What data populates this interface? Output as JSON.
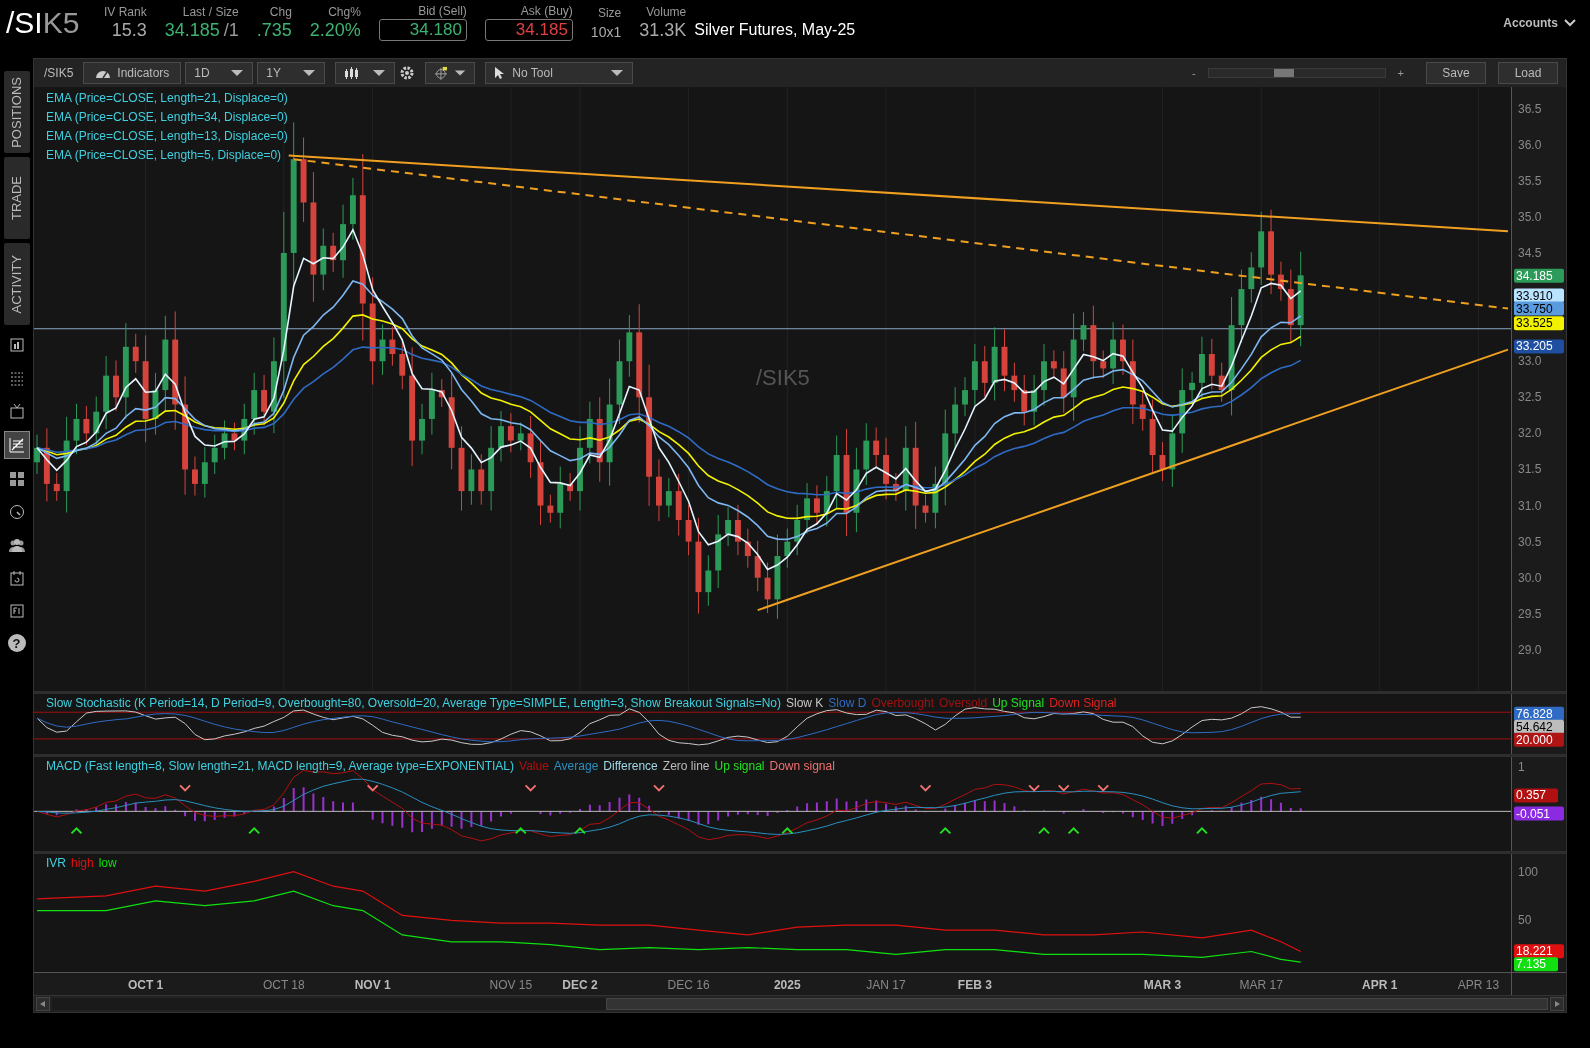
{
  "header": {
    "root": "/SI",
    "contract": "K5",
    "quote": [
      {
        "label": "IV Rank",
        "value": "15.3",
        "kind": "plain"
      },
      {
        "label": "Last / Size",
        "value": "34.185",
        "suffix": "/1",
        "kind": "up"
      },
      {
        "label": "Chg",
        "value": ".735",
        "kind": "up"
      },
      {
        "label": "Chg%",
        "value": "2.20%",
        "kind": "up"
      },
      {
        "label": "Bid (Sell)",
        "value": "34.180",
        "kind": "bid"
      },
      {
        "label": "Ask (Buy)",
        "value": "34.185",
        "kind": "ask"
      },
      {
        "label": "Size",
        "value": "10x1",
        "kind": "small"
      },
      {
        "label": "Volume",
        "value": "31.3K",
        "kind": "plain"
      }
    ],
    "description": "Silver Futures, May-25",
    "accounts": "Accounts"
  },
  "sidebar": {
    "tabs": [
      "POSITIONS",
      "TRADE",
      "ACTIVITY"
    ],
    "tools": [
      {
        "kind": "news",
        "selected": false
      },
      {
        "kind": "list",
        "selected": false
      },
      {
        "kind": "tv",
        "selected": false
      },
      {
        "kind": "chart",
        "selected": true
      },
      {
        "kind": "grid",
        "selected": false
      },
      {
        "kind": "gauge",
        "selected": false
      },
      {
        "kind": "people",
        "selected": false
      },
      {
        "kind": "calendar",
        "selected": false
      },
      {
        "kind": "keys",
        "selected": false
      }
    ],
    "help": "?"
  },
  "toolbar": {
    "symbol": "/SIK5",
    "indicators": "Indicators",
    "aggregation": "1D",
    "range": "1Y",
    "tool": "No Tool",
    "zoom_out": "-",
    "zoom_in": "+",
    "zoom_slider": {
      "level": 0.42
    },
    "save": "Save",
    "load": "Load"
  },
  "price_panel": {
    "studies": [
      "EMA (Price=CLOSE, Length=21, Displace=0)",
      "EMA (Price=CLOSE, Length=34, Displace=0)",
      "EMA (Price=CLOSE, Length=13, Displace=0)",
      "EMA (Price=CLOSE, Length=5, Displace=0)"
    ],
    "watermark": "/SIK5",
    "axis_labels": [
      "36.5",
      "36.0",
      "35.5",
      "35.0",
      "34.5",
      "33.0",
      "32.5",
      "32.0",
      "31.5",
      "31.0",
      "30.5",
      "30.0",
      "29.5",
      "29.0"
    ],
    "tags": [
      {
        "text": "34.185",
        "color": "#2c9a58"
      },
      {
        "text": "33.910",
        "color": "#b8e4ff"
      },
      {
        "text": "33.750",
        "color": "#5a9be0"
      },
      {
        "text": "33.525",
        "color": "#f2f200"
      },
      {
        "text": "33.205",
        "color": "#1f4fa0"
      }
    ]
  },
  "stochastic_panel": {
    "title": "Slow Stochastic (K Period=14, D Period=9, Overbought=80, Oversold=20, Average Type=SIMPLE, Length=3, Show Breakout Signals=No)",
    "legend": [
      {
        "label": "Slow K",
        "color": "#c8c8c8"
      },
      {
        "label": "Slow D",
        "color": "#2f6bc4"
      },
      {
        "label": "Overbought",
        "color": "#a01010"
      },
      {
        "label": "Oversold",
        "color": "#a01010"
      },
      {
        "label": "Up Signal",
        "color": "#20e020"
      },
      {
        "label": "Down Signal",
        "color": "#e02020"
      }
    ],
    "tags": [
      {
        "text": "76.828",
        "color": "#2f6bc4"
      },
      {
        "text": "54.642",
        "color": "#bdbdbd"
      },
      {
        "text": "20.000",
        "color": "#b01515"
      }
    ]
  },
  "macd_panel": {
    "title": "MACD (Fast length=8, Slow length=21, MACD length=9, Average type=EXPONENTIAL)",
    "legend": [
      {
        "label": "Value",
        "color": "#b01010"
      },
      {
        "label": "Average",
        "color": "#2a8fbf"
      },
      {
        "label": "Difference",
        "color": "#9fd8e8"
      },
      {
        "label": "Zero line",
        "color": "#bbbbbb"
      },
      {
        "label": "Up signal",
        "color": "#20e020"
      },
      {
        "label": "Down signal",
        "color": "#f07070"
      }
    ],
    "axis_labels": [
      "1"
    ],
    "tags": [
      {
        "text": "0.357",
        "color": "#b01010"
      },
      {
        "text": "-0.051",
        "color": "#8a2be2"
      }
    ]
  },
  "ivr_panel": {
    "title": "IVR",
    "legend": [
      {
        "label": "high",
        "color": "#e01010"
      },
      {
        "label": "low",
        "color": "#10e010"
      }
    ],
    "axis_labels": [
      "100",
      "50"
    ],
    "tags": [
      {
        "text": "18.221",
        "color": "#e01010"
      },
      {
        "text": "7.135",
        "color": "#10e010"
      }
    ]
  },
  "date_axis": [
    {
      "label": "OCT 1",
      "major": true
    },
    {
      "label": "OCT 18",
      "major": false
    },
    {
      "label": "NOV 1",
      "major": true
    },
    {
      "label": "NOV 15",
      "major": false
    },
    {
      "label": "DEC 2",
      "major": true
    },
    {
      "label": "DEC 16",
      "major": false
    },
    {
      "label": "2025",
      "major": true
    },
    {
      "label": "JAN 17",
      "major": false
    },
    {
      "label": "FEB 3",
      "major": true
    },
    {
      "label": "MAR 3",
      "major": true
    },
    {
      "label": "MAR 17",
      "major": false
    },
    {
      "label": "APR 1",
      "major": true
    },
    {
      "label": "APR 13",
      "major": false
    }
  ]
}
